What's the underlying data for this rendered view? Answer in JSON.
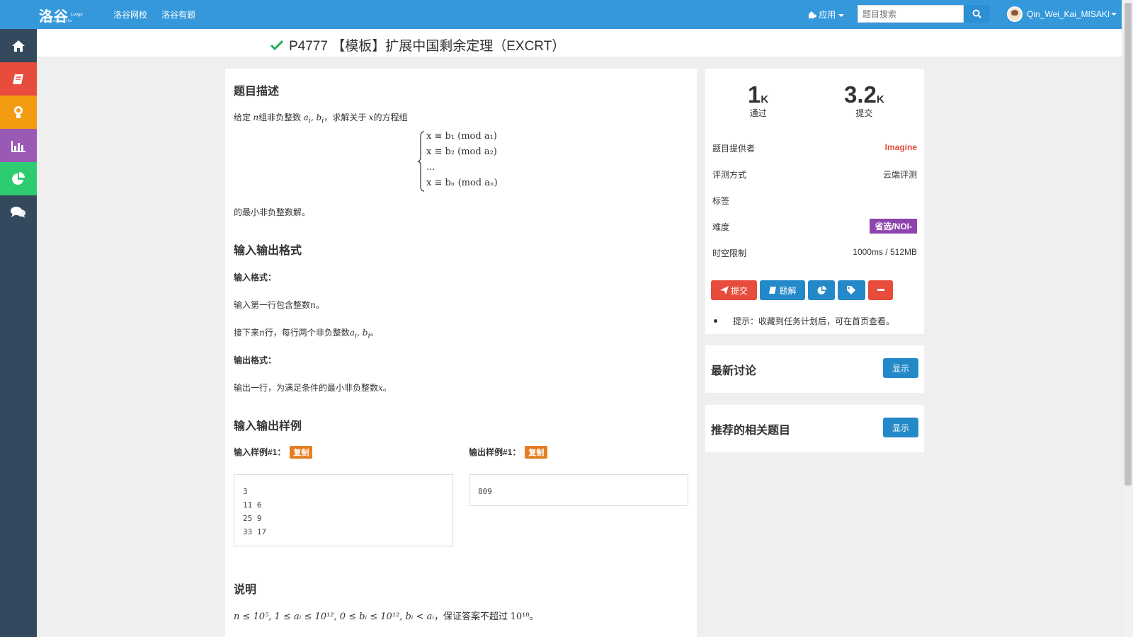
{
  "topbar": {
    "logo_text": "洛谷",
    "logo_sub": "Luogu",
    "logo_tagline": "enjoy coding life",
    "nav": [
      "洛谷网校",
      "洛谷有题"
    ],
    "apps_label": "应用",
    "search_placeholder": "题目搜索",
    "username": "Qin_Wei_Kai_MISAKI"
  },
  "sidebar": {
    "items": [
      {
        "icon": "home-icon",
        "color": "#34495e"
      },
      {
        "icon": "book-icon",
        "color": "#e74c3c"
      },
      {
        "icon": "lightbulb-icon",
        "color": "#f39c12"
      },
      {
        "icon": "bar-chart-icon",
        "color": "#9b59b6"
      },
      {
        "icon": "pie-chart-icon",
        "color": "#2ecc71"
      },
      {
        "icon": "comments-icon",
        "color": "#34495e"
      }
    ]
  },
  "problem": {
    "title": "P4777 【模板】扩展中国剩余定理（EXCRT）",
    "sections": {
      "description": "题目描述",
      "io_format": "输入输出格式",
      "samples": "输入输出样例",
      "hint": "说明"
    },
    "desc": {
      "p1_a": "给定",
      "p1_b": "组非负整数",
      "p1_c": "，求解关于",
      "p1_d": "的方程组",
      "p2": "的最小非负整数解。"
    },
    "system": {
      "lines": [
        "x ≡ b₁ (mod a₁)",
        "x ≡ b₂ (mod a₂)",
        "...",
        "x ≡ bₙ (mod aₙ)"
      ]
    },
    "input_label": "输入格式：",
    "input_line1_a": "输入第一行包含整数",
    "input_line1_b": "。",
    "input_line2_a": "接下来",
    "input_line2_b": "行，每行两个非负整数",
    "input_line2_c": "。",
    "output_label": "输出格式：",
    "output_line_a": "输出一行，为满足条件的最小非负整数",
    "output_line_b": "。",
    "sample_input_label": "输入样例#1：",
    "sample_output_label": "输出样例#1：",
    "copy_label": "复制",
    "sample_input": "3\n11 6\n25 9\n33 17",
    "sample_output": "809",
    "hint_text": "n ≤ 10⁵, 1 ≤ aᵢ ≤ 10¹², 0 ≤ bᵢ ≤ 10¹², bᵢ < aᵢ",
    "hint_suffix": "，保证答案不超过",
    "hint_end": "10¹⁸。"
  },
  "info": {
    "accepted_num": "1",
    "accepted_unit": "K",
    "accepted_label": "通过",
    "submitted_num": "3.2",
    "submitted_unit": "K",
    "submitted_label": "提交",
    "provider_label": "题目提供者",
    "provider_value": "Imagine",
    "judge_label": "评测方式",
    "judge_value": "云端评测",
    "tags_label": "标签",
    "difficulty_label": "难度",
    "difficulty_value": "省选/NOI-",
    "limit_label": "时空限制",
    "limit_value": "1000ms / 512MB",
    "submit_btn": "提交",
    "solution_btn": "题解",
    "tip": "提示：收藏到任务计划后，可在首页查看。"
  },
  "panels": {
    "discussion_title": "最新讨论",
    "related_title": "推荐的相关题目",
    "show_label": "显示"
  },
  "colors": {
    "topbar": "#3498db",
    "sidebar": "#34495e",
    "accent_red": "#e74c3c",
    "accent_blue": "#2389c9",
    "difficulty": "#8e44ad",
    "copy_badge": "#e67e22",
    "check_green": "#27ae60"
  }
}
